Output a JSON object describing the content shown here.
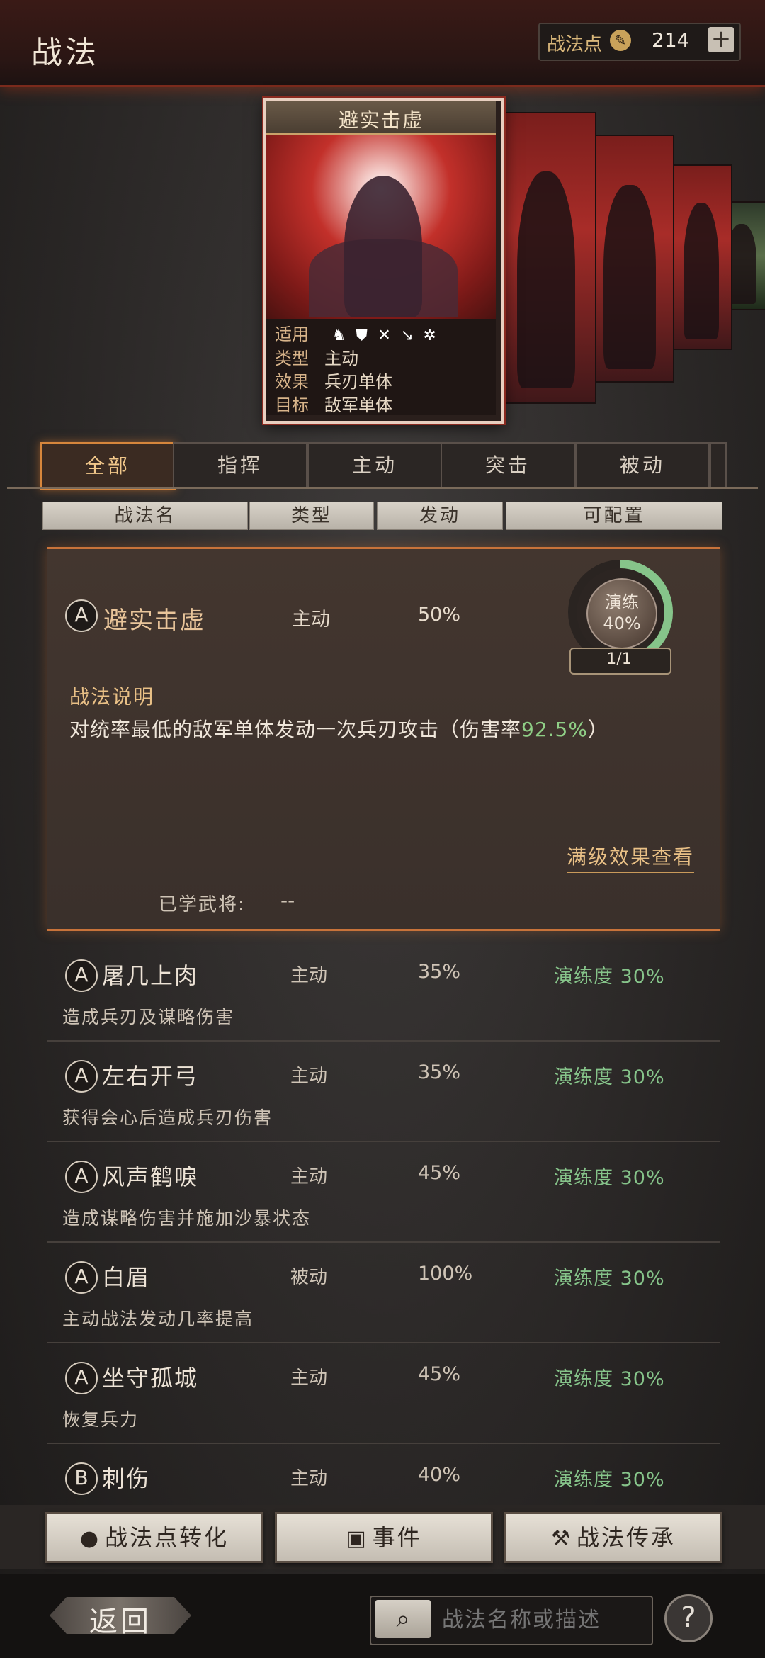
{
  "header": {
    "title": "战法",
    "points_label": "战法点",
    "points_value": "214",
    "add_label": "+"
  },
  "card": {
    "title": "避实击虚",
    "rows": [
      {
        "key": "适用",
        "value": ""
      },
      {
        "key": "类型",
        "value": "主动"
      },
      {
        "key": "效果",
        "value": "兵刃单体"
      },
      {
        "key": "目标",
        "value": "敌军单体"
      }
    ],
    "unit_icons": [
      "cavalry-icon",
      "shield-icon",
      "bow-icon",
      "spear-icon",
      "wheel-icon"
    ]
  },
  "tabs": [
    {
      "label": "全部",
      "active": true
    },
    {
      "label": "指挥",
      "active": false
    },
    {
      "label": "主动",
      "active": false
    },
    {
      "label": "突击",
      "active": false
    },
    {
      "label": "被动",
      "active": false
    }
  ],
  "columns": [
    "战法名",
    "类型",
    "发动",
    "可配置"
  ],
  "expanded": {
    "grade": "A",
    "name": "避实击虚",
    "type": "主动",
    "rate": "50%",
    "proficiency_label": "演练",
    "proficiency_pct": "40%",
    "proficiency_value": 0.4,
    "count": "1/1",
    "desc_title": "战法说明",
    "desc_prefix": "对统率最低的敌军单体发动一次兵刃攻击（伤害率",
    "desc_rate": "92.5%",
    "desc_suffix": "）",
    "max_effect": "满级效果查看",
    "learned_label": "已学武将:",
    "learned_value": "--"
  },
  "items": [
    {
      "grade": "A",
      "name": "屠几上肉",
      "type": "主动",
      "rate": "35%",
      "prof": "演练度 30%",
      "desc": "造成兵刃及谋略伤害"
    },
    {
      "grade": "A",
      "name": "左右开弓",
      "type": "主动",
      "rate": "35%",
      "prof": "演练度 30%",
      "desc": "获得会心后造成兵刃伤害"
    },
    {
      "grade": "A",
      "name": "风声鹤唳",
      "type": "主动",
      "rate": "45%",
      "prof": "演练度 30%",
      "desc": "造成谋略伤害并施加沙暴状态"
    },
    {
      "grade": "A",
      "name": "白眉",
      "type": "被动",
      "rate": "100%",
      "prof": "演练度 30%",
      "desc": "主动战法发动几率提高"
    },
    {
      "grade": "A",
      "name": "坐守孤城",
      "type": "主动",
      "rate": "45%",
      "prof": "演练度 30%",
      "desc": "恢复兵力"
    },
    {
      "grade": "B",
      "name": "刺伤",
      "type": "主动",
      "rate": "40%",
      "prof": "演练度 30%",
      "desc": ""
    }
  ],
  "bottom": {
    "convert_label": "战法点转化",
    "event_label": "事件",
    "inherit_label": "战法传承"
  },
  "footer": {
    "back_label": "返回",
    "search_placeholder": "战法名称或描述",
    "help_label": "?"
  },
  "colors": {
    "accent": "#d6863c",
    "proficiency": "#86c48a",
    "rate_highlight": "#8fcf86"
  }
}
